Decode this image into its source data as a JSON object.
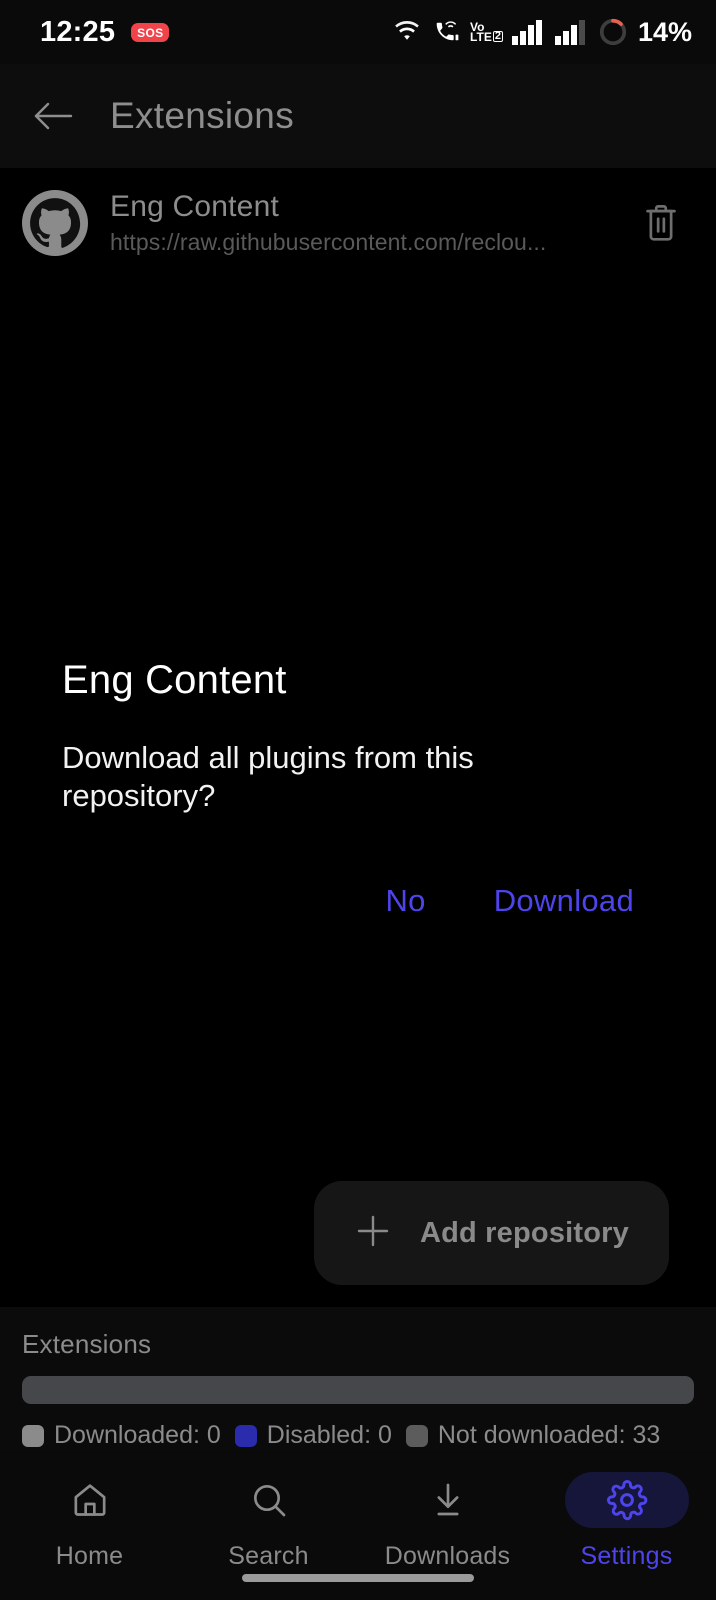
{
  "status_bar": {
    "time": "12:25",
    "sos_label": "SOS",
    "battery_percent": "14%",
    "icons": [
      "wifi-icon",
      "call-wifi-icon",
      "volte-icon",
      "signal-bars-sim1-icon",
      "signal-bars-sim2-icon",
      "battery-ring-icon"
    ],
    "volte": {
      "vo": "Vo",
      "lte": "LTE",
      "sim": "2"
    }
  },
  "app_bar": {
    "back_icon": "back-arrow-icon",
    "title": "Extensions"
  },
  "repository": {
    "avatar_icon": "github-octocat-icon",
    "name": "Eng Content",
    "url": "https://raw.githubusercontent.com/reclou...",
    "delete_icon": "trash-icon"
  },
  "dialog": {
    "title": "Eng Content",
    "message": "Download all plugins from this repository?",
    "negative_label": "No",
    "positive_label": "Download",
    "accent_color": "#4e44ec"
  },
  "add_repository": {
    "plus_icon": "plus-icon",
    "label": "Add repository"
  },
  "stats": {
    "title": "Extensions",
    "progress_percent": 0,
    "legend": [
      {
        "label": "Downloaded: 0",
        "color": "#8b8b8b"
      },
      {
        "label": "Disabled: 0",
        "color": "#2b2bad"
      },
      {
        "label": "Not downloaded: 33",
        "color": "#5c5c5c"
      }
    ]
  },
  "bottom_nav": {
    "items": [
      {
        "label": "Home",
        "icon": "home-icon",
        "active": false
      },
      {
        "label": "Search",
        "icon": "search-icon",
        "active": false
      },
      {
        "label": "Downloads",
        "icon": "download-icon",
        "active": false
      },
      {
        "label": "Settings",
        "icon": "gear-icon",
        "active": true
      }
    ]
  }
}
